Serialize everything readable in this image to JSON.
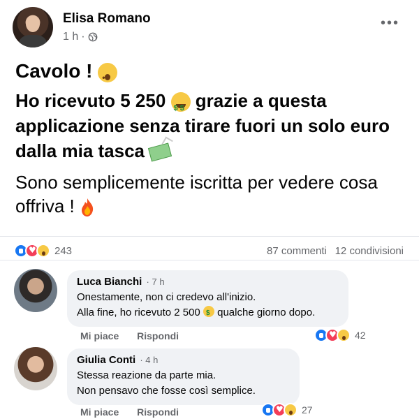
{
  "post": {
    "author": "Elisa Romano",
    "time": "1 h",
    "separator": "·",
    "more_icon": "more-dots-icon",
    "line1": "Cavolo !",
    "line2_a": "Ho ricevuto 5 250",
    "line2_b": "grazie a questa applicazione senza tirare fuori un solo euro dalla mia tasca",
    "line3": "Sono semplicemente iscritta per vedere cosa offriva !"
  },
  "stats": {
    "reactions_count": "243",
    "comments": "87 commenti",
    "shares": "12 condivisioni"
  },
  "comments": [
    {
      "name": "Luca Bianchi",
      "time": "· 7 h",
      "text_1": "Onestamente, non ci credevo all'inizio.",
      "text_2a": "Alla fine, ho ricevuto 2 500",
      "text_2b": "qualche giorno dopo.",
      "like_label": "Mi piace",
      "reply_label": "Rispondi",
      "reactions_count": "42"
    },
    {
      "name": "Giulia Conti",
      "time": "· 4 h",
      "text_1": "Stessa reazione da parte mia.",
      "text_2": "Non pensavo che fosse così semplice.",
      "like_label": "Mi piace",
      "reply_label": "Rispondi",
      "reactions_count": "27"
    }
  ],
  "colors": {
    "like_blue": "#1877f2",
    "love_red": "#f33e58",
    "wow_yellow": "#f7c945",
    "meta_gray": "#65676b",
    "bubble_bg": "#f0f2f5"
  }
}
